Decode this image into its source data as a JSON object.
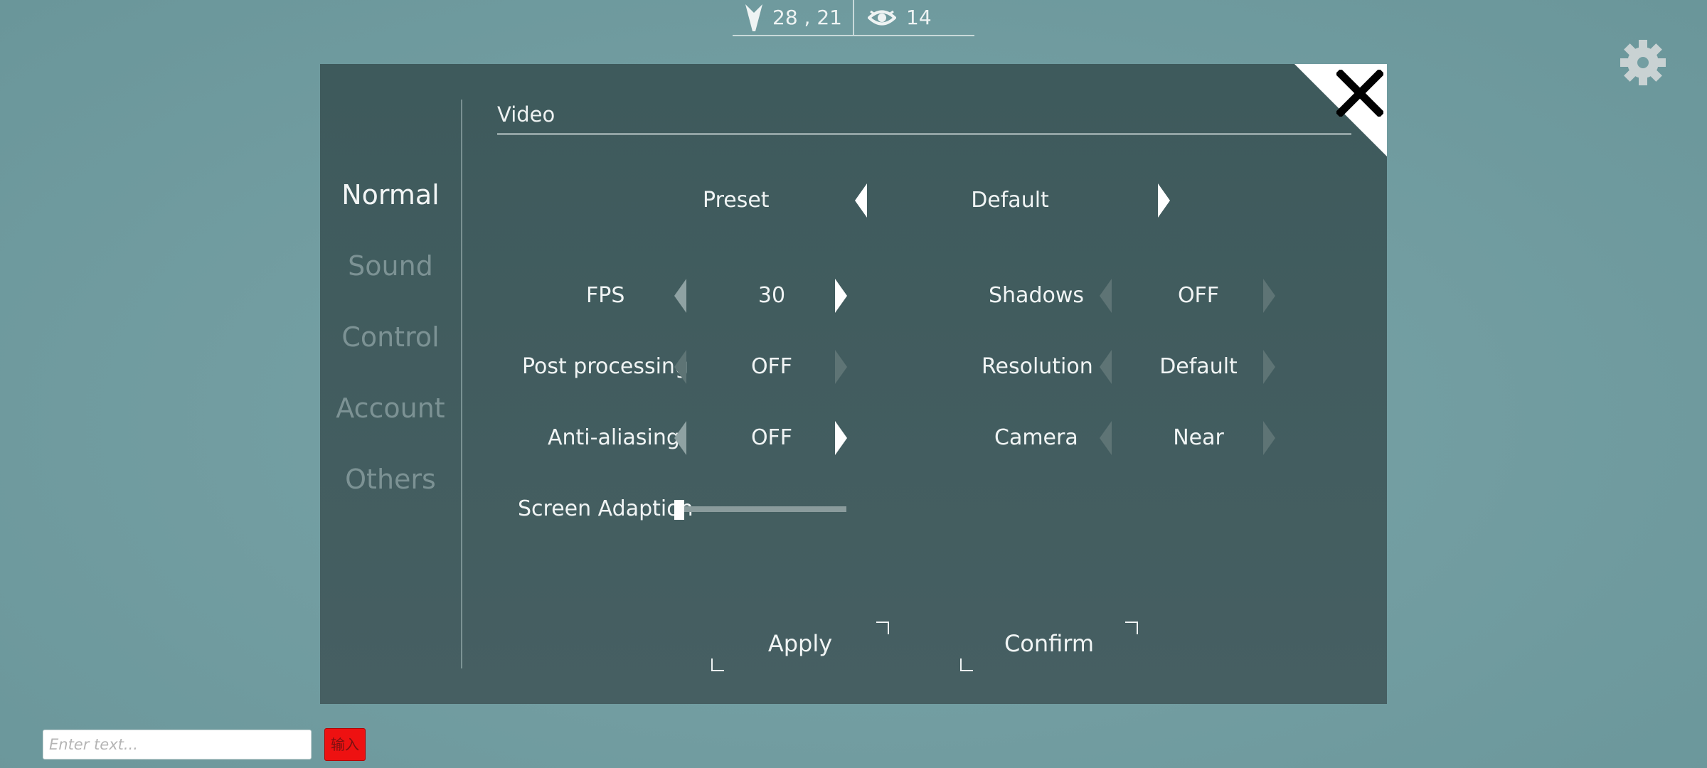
{
  "hud": {
    "coords": "28 , 21",
    "views": "14",
    "coords_icon": "direction-arrow-icon",
    "views_icon": "eye-icon"
  },
  "settings_icon": "gear-icon",
  "sidebar": {
    "items": [
      {
        "label": "Normal",
        "active": true
      },
      {
        "label": "Sound",
        "active": false
      },
      {
        "label": "Control",
        "active": false
      },
      {
        "label": "Account",
        "active": false
      },
      {
        "label": "Others",
        "active": false
      }
    ]
  },
  "section": {
    "title": "Video"
  },
  "options": {
    "preset": {
      "label": "Preset",
      "value": "Default"
    },
    "fps": {
      "label": "FPS",
      "value": "30"
    },
    "post_processing": {
      "label": "Post processing",
      "value": "OFF"
    },
    "anti_aliasing": {
      "label": "Anti-aliasing",
      "value": "OFF"
    },
    "shadows": {
      "label": "Shadows",
      "value": "OFF"
    },
    "resolution": {
      "label": "Resolution",
      "value": "Default"
    },
    "camera": {
      "label": "Camera",
      "value": "Near"
    },
    "screen_adaption": {
      "label": "Screen Adaption",
      "level": 0
    }
  },
  "buttons": {
    "apply": "Apply",
    "confirm": "Confirm",
    "close_icon": "close-icon"
  },
  "input": {
    "placeholder": "Enter text...",
    "value": "",
    "send_label": "输入"
  },
  "colors": {
    "background": "#739ea2",
    "panel": "#425d60",
    "active_tab": "#f2f5f5",
    "inactive_tab": "#7c9294",
    "send_button": "#ee1111"
  }
}
